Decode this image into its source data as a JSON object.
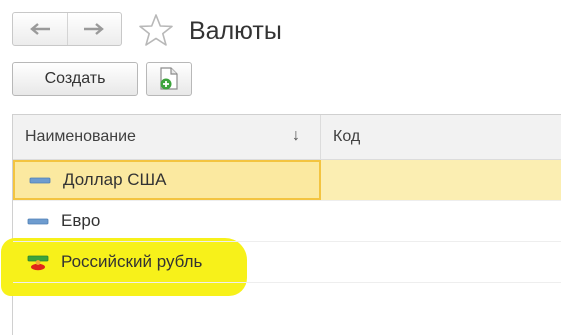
{
  "window": {
    "title": "Валюты"
  },
  "toolbar": {
    "create_label": "Создать"
  },
  "table": {
    "columns": [
      "Наименование",
      "Код"
    ],
    "sort_indicator": "↓",
    "rows": [
      {
        "name": "Доллар США",
        "code": "",
        "icon": "catalog-item-icon",
        "selected": true
      },
      {
        "name": "Евро",
        "code": "",
        "icon": "catalog-item-icon",
        "selected": false
      },
      {
        "name": "Российский рубль",
        "code": "",
        "icon": "catalog-item-marked-icon",
        "selected": false,
        "highlighted": true
      }
    ]
  },
  "icons": {
    "back": "arrow-left-icon",
    "forward": "arrow-right-icon",
    "favorite": "star-icon",
    "new_doc": "new-document-icon"
  },
  "colors": {
    "selected_row": "#fbeeb2",
    "selected_border": "#f3c440",
    "highlight_marker": "#f7f11a",
    "icon_blue": "#6e9ccf",
    "icon_green": "#3ca33c",
    "icon_red": "#e0261b"
  }
}
